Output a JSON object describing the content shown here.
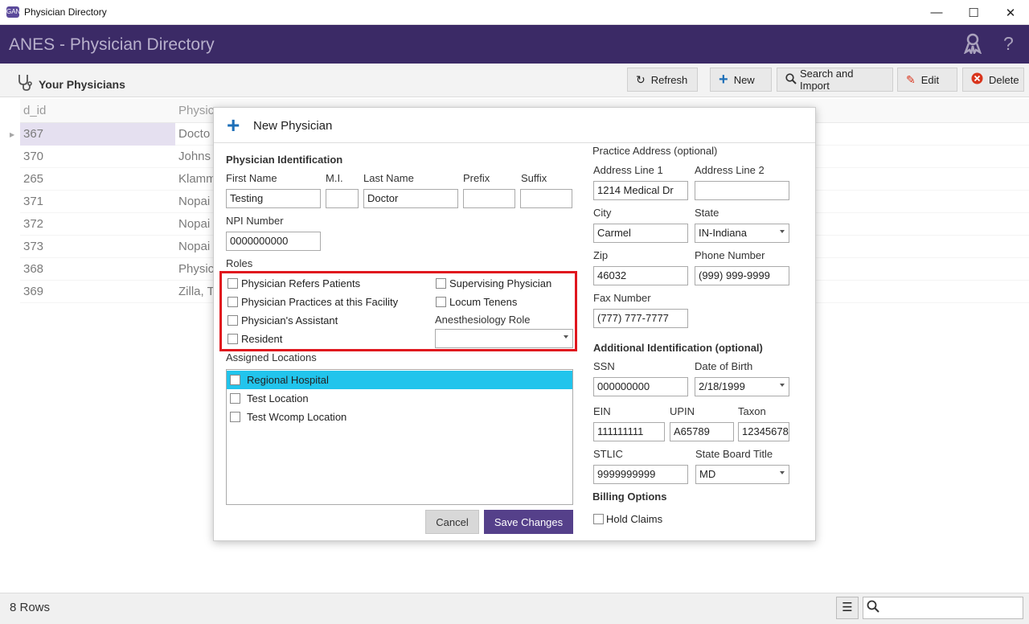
{
  "window": {
    "title": "Physician Directory",
    "icon_text": "GAN",
    "minimize": "—",
    "maximize": "☐",
    "close": "✕"
  },
  "header": {
    "title": "ANES - Physician Directory",
    "badge_icon": "ribbon-icon",
    "help_icon": "?"
  },
  "toolbar": {
    "section_title": "Your Physicians",
    "refresh": "Refresh",
    "new": "New",
    "search_import": "Search and Import",
    "edit": "Edit",
    "delete": "Delete"
  },
  "grid": {
    "columns": [
      "d_id",
      "Physic"
    ],
    "rows": [
      {
        "id": "367",
        "name": "Docto"
      },
      {
        "id": "370",
        "name": "Johns"
      },
      {
        "id": "265",
        "name": "Klamm"
      },
      {
        "id": "371",
        "name": "Nopai"
      },
      {
        "id": "372",
        "name": "Nopai"
      },
      {
        "id": "373",
        "name": "Nopai"
      },
      {
        "id": "368",
        "name": "Physic"
      },
      {
        "id": "369",
        "name": "Zilla, T"
      }
    ]
  },
  "status": {
    "rows": "8 Rows",
    "search_value": ""
  },
  "modal": {
    "title": "New Physician",
    "physician_identification": {
      "heading": "Physician Identification",
      "first_name_label": "First Name",
      "first_name": "Testing",
      "mi_label": "M.I.",
      "mi": "",
      "last_name_label": "Last Name",
      "last_name": "Doctor",
      "prefix_label": "Prefix",
      "prefix": "",
      "suffix_label": "Suffix",
      "suffix": "",
      "npi_label": "NPI Number",
      "npi": "0000000000"
    },
    "roles": {
      "heading": "Roles",
      "refers_patients": "Physician Refers Patients",
      "practices_facility": "Physician Practices at this Facility",
      "assistant": "Physician's Assistant",
      "resident": "Resident",
      "supervising": "Supervising Physician",
      "locum_tenens": "Locum Tenens",
      "anesthesiology_role_label": "Anesthesiology Role",
      "anesthesiology_role": ""
    },
    "locations": {
      "heading": "Assigned Locations",
      "items": [
        "Regional Hospital",
        "Test Location",
        "Test Wcomp Location"
      ]
    },
    "practice_address": {
      "heading": "Practice Address (optional)",
      "line1_label": "Address Line 1",
      "line1": "1214 Medical Dr",
      "line2_label": "Address Line 2",
      "line2": "",
      "city_label": "City",
      "city": "Carmel",
      "state_label": "State",
      "state": "IN-Indiana",
      "zip_label": "Zip",
      "zip": "46032",
      "phone_label": "Phone Number",
      "phone": "(999) 999-9999",
      "fax_label": "Fax Number",
      "fax": "(777) 777-7777"
    },
    "additional_identification": {
      "heading": "Additional Identification (optional)",
      "ssn_label": "SSN",
      "ssn": "000000000",
      "dob_label": "Date of Birth",
      "dob": "2/18/1999",
      "ein_label": "EIN",
      "ein": "111111111",
      "upin_label": "UPIN",
      "upin": "A65789",
      "taxon_label": "Taxon",
      "taxon": "12345678",
      "stlic_label": "STLIC",
      "stlic": "9999999999",
      "board_title_label": "State Board Title",
      "board_title": "MD"
    },
    "billing": {
      "heading": "Billing Options",
      "hold_claims": "Hold Claims"
    },
    "cancel": "Cancel",
    "save": "Save Changes"
  }
}
